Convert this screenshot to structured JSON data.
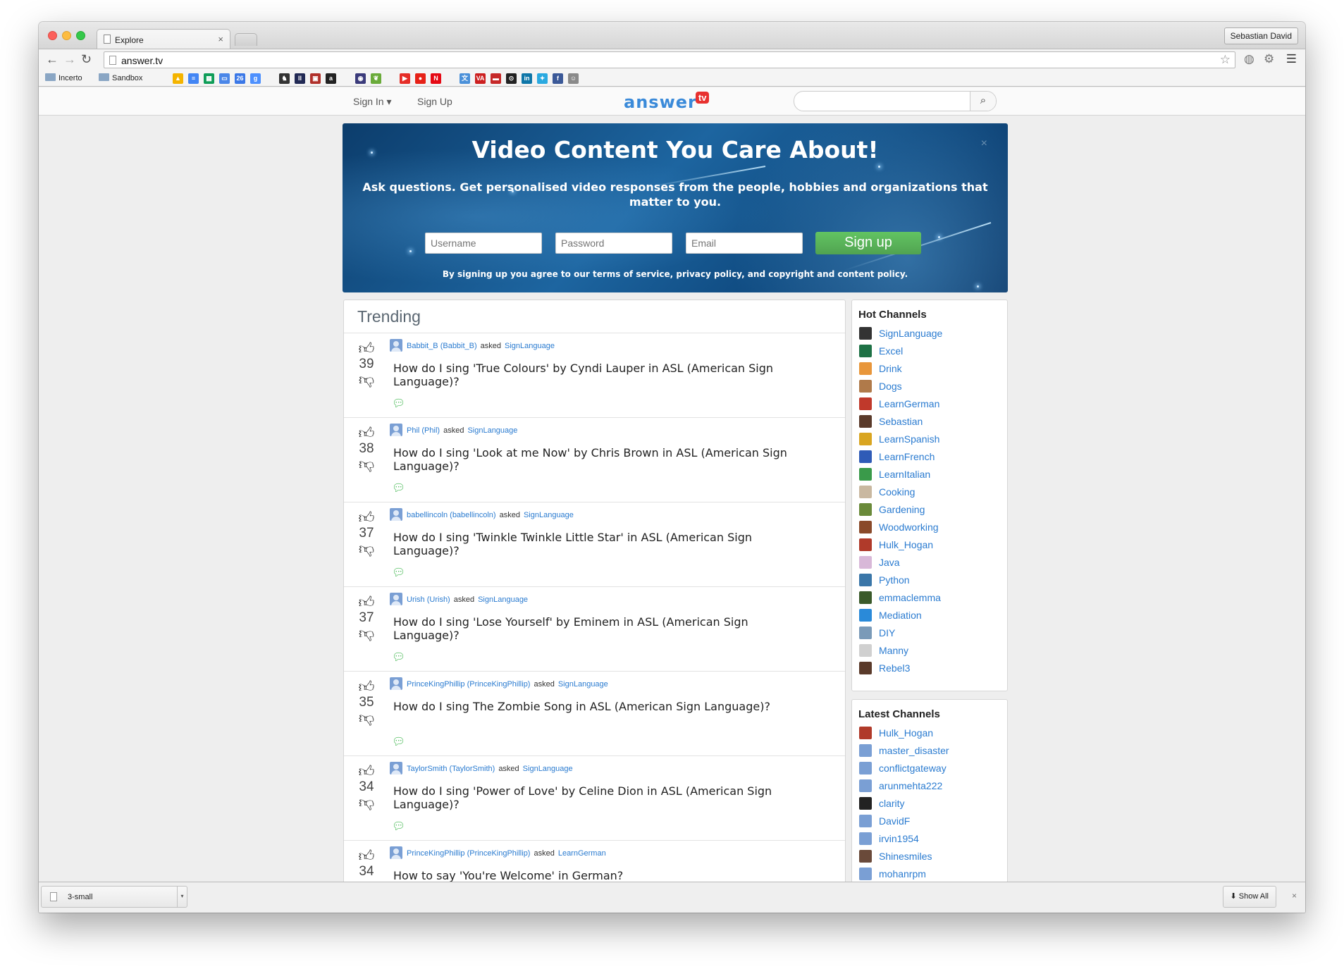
{
  "browser": {
    "tab_title": "Explore",
    "tab_close": "×",
    "profile_name": "Sebastian David",
    "url": "answer.tv",
    "bookmarks": [
      {
        "label": "Incerto",
        "icon": "folder-icon"
      },
      {
        "label": "Sandbox",
        "icon": "folder-icon"
      }
    ],
    "bookmark_icons": [
      {
        "name": "google-drive-icon",
        "color": "#f4b400",
        "glyph": "▲"
      },
      {
        "name": "google-docs-icon",
        "color": "#4285f4",
        "glyph": "≡"
      },
      {
        "name": "google-sheets-icon",
        "color": "#0f9d58",
        "glyph": "▦"
      },
      {
        "name": "google-slides-icon",
        "color": "#4a86e8",
        "glyph": "▭"
      },
      {
        "name": "google-calendar-icon",
        "color": "#3b78e7",
        "glyph": "26"
      },
      {
        "name": "google-plus-icon",
        "color": "#4d90fe",
        "glyph": "g"
      },
      {
        "name": "rider-icon",
        "color": "#333333",
        "glyph": "♞"
      },
      {
        "name": "library-icon",
        "color": "#222a55",
        "glyph": "II"
      },
      {
        "name": "tv-icon",
        "color": "#b0302a",
        "glyph": "▣"
      },
      {
        "name": "amazon-icon",
        "color": "#222222",
        "glyph": "a"
      },
      {
        "name": "badge-icon",
        "color": "#3a3a7a",
        "glyph": "◉"
      },
      {
        "name": "leaf-icon",
        "color": "#6aab3a",
        "glyph": "❦"
      },
      {
        "name": "youtube-icon",
        "color": "#e52d27",
        "glyph": "▶"
      },
      {
        "name": "play-icon",
        "color": "#e62117",
        "glyph": "●"
      },
      {
        "name": "netflix-icon",
        "color": "#e50914",
        "glyph": "N"
      },
      {
        "name": "translate-icon",
        "color": "#4a90d9",
        "glyph": "文"
      },
      {
        "name": "va-icon",
        "color": "#cc1f1f",
        "glyph": "VA"
      },
      {
        "name": "flag-icon",
        "color": "#c62828",
        "glyph": "▬"
      },
      {
        "name": "github-icon",
        "color": "#222222",
        "glyph": "⊙"
      },
      {
        "name": "linkedin-icon",
        "color": "#0e76a8",
        "glyph": "in"
      },
      {
        "name": "twitter-icon",
        "color": "#2aa9e0",
        "glyph": "✦"
      },
      {
        "name": "facebook-icon",
        "color": "#3b5998",
        "glyph": "f"
      },
      {
        "name": "reddit-icon",
        "color": "#8a8a8a",
        "glyph": "☺"
      }
    ]
  },
  "site": {
    "nav_signin": "Sign In ▾",
    "nav_signup": "Sign Up",
    "logo_word": "answer",
    "logo_tv": "tv",
    "search_placeholder": ""
  },
  "hero": {
    "title": "Video Content You Care About!",
    "subtitle": "Ask questions. Get personalised video responses from the people, hobbies and organizations that matter to you.",
    "close": "×",
    "username_placeholder": "Username",
    "password_placeholder": "Password",
    "email_placeholder": "Email",
    "signup_button": "Sign up",
    "terms": "By signing up you agree to our terms of service, privacy policy, and copyright and content policy."
  },
  "trending": {
    "heading": "Trending",
    "asked_word": "asked",
    "questions": [
      {
        "votes": "39",
        "user": "Babbit_B (Babbit_B)",
        "channel": "SignLanguage",
        "text": "How do I sing 'True Colours' by Cyndi Lauper in ASL (American Sign Language)?"
      },
      {
        "votes": "38",
        "user": "Phil (Phil)",
        "channel": "SignLanguage",
        "text": "How do I sing 'Look at me Now' by Chris Brown in ASL (American Sign Language)?"
      },
      {
        "votes": "37",
        "user": "babellincoln (babellincoln)",
        "channel": "SignLanguage",
        "text": "How do I sing 'Twinkle Twinkle Little Star' in ASL (American Sign Language)?"
      },
      {
        "votes": "37",
        "user": "Urish (Urish)",
        "channel": "SignLanguage",
        "text": "How do I sing 'Lose Yourself' by Eminem in ASL (American Sign Language)?"
      },
      {
        "votes": "35",
        "user": "PrinceKingPhillip (PrinceKingPhillip)",
        "channel": "SignLanguage",
        "text": "How do I sing The Zombie Song in ASL (American Sign Language)?"
      },
      {
        "votes": "34",
        "user": "TaylorSmith (TaylorSmith)",
        "channel": "SignLanguage",
        "text": "How do I sing 'Power of Love' by Celine Dion in ASL (American Sign Language)?"
      },
      {
        "votes": "34",
        "user": "PrinceKingPhillip (PrinceKingPhillip)",
        "channel": "LearnGerman",
        "text": "How to say 'You're Welcome' in German?"
      }
    ]
  },
  "hot_channels": {
    "heading": "Hot Channels",
    "items": [
      {
        "name": "SignLanguage",
        "color": "#333333"
      },
      {
        "name": "Excel",
        "color": "#1e7145"
      },
      {
        "name": "Drink",
        "color": "#e8963a"
      },
      {
        "name": "Dogs",
        "color": "#b07a4a"
      },
      {
        "name": "LearnGerman",
        "color": "#c0392b"
      },
      {
        "name": "Sebastian",
        "color": "#5a3a2a"
      },
      {
        "name": "LearnSpanish",
        "color": "#d9a520"
      },
      {
        "name": "LearnFrench",
        "color": "#2f5bb7"
      },
      {
        "name": "LearnItalian",
        "color": "#3a9a4a"
      },
      {
        "name": "Cooking",
        "color": "#c9b8a0"
      },
      {
        "name": "Gardening",
        "color": "#6a8a3a"
      },
      {
        "name": "Woodworking",
        "color": "#8a4a2a"
      },
      {
        "name": "Hulk_Hogan",
        "color": "#b03a2a"
      },
      {
        "name": "Java",
        "color": "#d8b8d8"
      },
      {
        "name": "Python",
        "color": "#3a76a8"
      },
      {
        "name": "emmaclemma",
        "color": "#3a5a2a"
      },
      {
        "name": "Mediation",
        "color": "#2a8ad9"
      },
      {
        "name": "DIY",
        "color": "#7a9ab8"
      },
      {
        "name": "Manny",
        "color": "#d0d0d0"
      },
      {
        "name": "Rebel3",
        "color": "#5a3a2a"
      }
    ]
  },
  "latest_channels": {
    "heading": "Latest Channels",
    "items": [
      {
        "name": "Hulk_Hogan",
        "color": "#b03a2a"
      },
      {
        "name": "master_disaster",
        "color": "#7a9fd4"
      },
      {
        "name": "conflictgateway",
        "color": "#7a9fd4"
      },
      {
        "name": "arunmehta222",
        "color": "#7a9fd4"
      },
      {
        "name": "clarity",
        "color": "#222222"
      },
      {
        "name": "DavidF",
        "color": "#7a9fd4"
      },
      {
        "name": "irvin1954",
        "color": "#7a9fd4"
      },
      {
        "name": "Shinesmiles",
        "color": "#6a4a3a"
      },
      {
        "name": "mohanrpm",
        "color": "#7a9fd4"
      }
    ]
  },
  "downloads": {
    "file_name": "3-small",
    "show_all": "⬇ Show All",
    "close": "×"
  }
}
